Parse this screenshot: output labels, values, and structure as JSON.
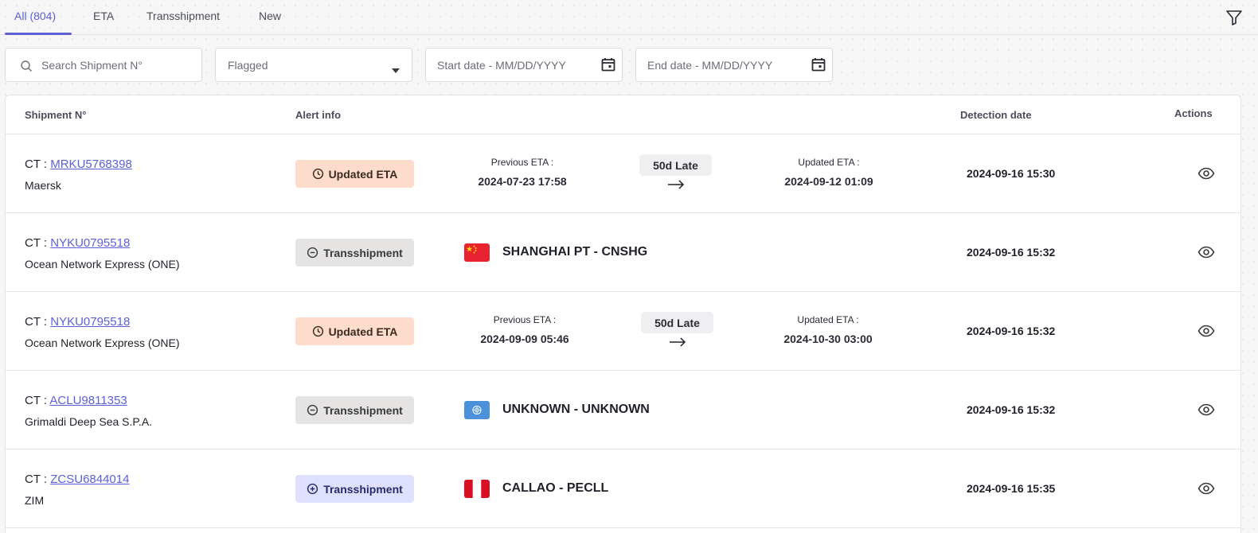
{
  "tabs": [
    {
      "label": "All (804)",
      "active": true
    },
    {
      "label": "ETA",
      "active": false
    },
    {
      "label": "Transshipment",
      "active": false
    },
    {
      "label": "New",
      "active": false
    }
  ],
  "filters": {
    "search_placeholder": "Search Shipment N°",
    "flagged_value": "Flagged",
    "start_date_placeholder": "Start date - MM/DD/YYYY",
    "end_date_placeholder": "End date - MM/DD/YYYY"
  },
  "table": {
    "headers": {
      "shipment": "Shipment N°",
      "alert": "Alert info",
      "detection": "Detection date",
      "actions": "Actions"
    },
    "ct_prefix": "CT : ",
    "rows": [
      {
        "ct": "MRKU5768398",
        "carrier": "Maersk",
        "badge": "Updated ETA",
        "badge_type": "eta",
        "prev_label": "Previous ETA :",
        "prev_eta": "2024-07-23 17:58",
        "late": "50d Late",
        "upd_label": "Updated ETA :",
        "upd_eta": "2024-09-12 01:09",
        "detection": "2024-09-16 15:30"
      },
      {
        "ct": "NYKU0795518",
        "carrier": "Ocean Network Express (ONE)",
        "badge": "Transshipment",
        "badge_type": "trans-minus",
        "port": "SHANGHAI PT - CNSHG",
        "flag": "china",
        "detection": "2024-09-16 15:32"
      },
      {
        "ct": "NYKU0795518",
        "carrier": "Ocean Network Express (ONE)",
        "badge": "Updated ETA",
        "badge_type": "eta",
        "prev_label": "Previous ETA :",
        "prev_eta": "2024-09-09 05:46",
        "late": "50d Late",
        "upd_label": "Updated ETA :",
        "upd_eta": "2024-10-30 03:00",
        "detection": "2024-09-16 15:32"
      },
      {
        "ct": "ACLU9811353",
        "carrier": "Grimaldi Deep Sea S.P.A.",
        "badge": "Transshipment",
        "badge_type": "trans-minus",
        "port": "UNKNOWN - UNKNOWN",
        "flag": "united-nations",
        "detection": "2024-09-16 15:32"
      },
      {
        "ct": "ZCSU6844014",
        "carrier": "ZIM",
        "badge": "Transshipment",
        "badge_type": "trans-plus",
        "port": "CALLAO - PECLL",
        "flag": "peru",
        "detection": "2024-09-16 15:35"
      }
    ]
  },
  "colors": {
    "accent": "#5b5fd6",
    "eta_badge": "#fedccb",
    "transshipment_badge": "#e6e3e3",
    "transshipment_plus_badge": "#dfe0fd"
  },
  "icons": [
    "filter-icon",
    "search-icon",
    "caret-down-icon",
    "calendar-icon",
    "clock-icon",
    "minus-circle-icon",
    "plus-circle-icon",
    "arrow-right-icon",
    "eye-icon"
  ]
}
